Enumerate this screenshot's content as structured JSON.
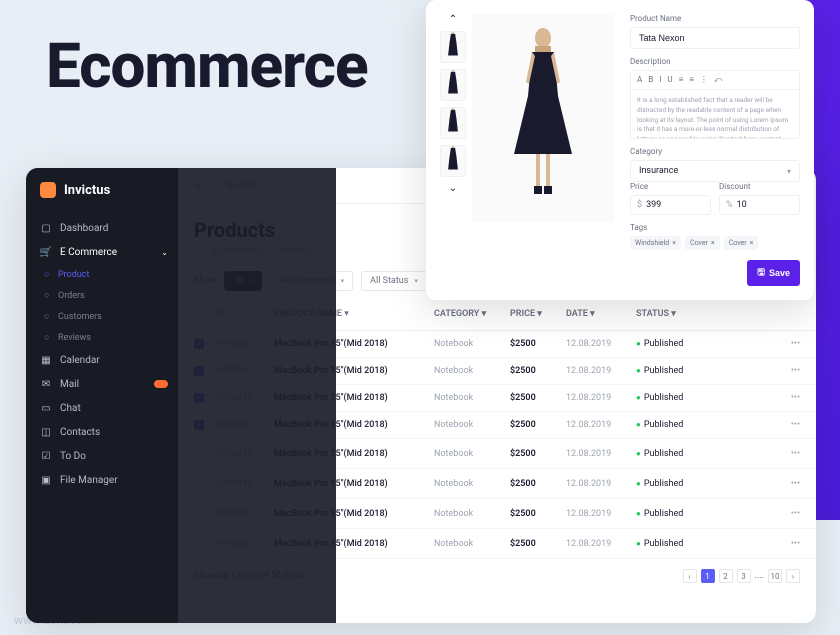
{
  "hero_title": "Ecommerce",
  "watermark": "www.25xt.com",
  "brand": "Invictus",
  "nav": {
    "dashboard": "Dashboard",
    "ecommerce": "E Commerce",
    "sub": [
      "Orders",
      "Customers",
      "Reviews"
    ],
    "sub_active": "Product",
    "calendar": "Calendar",
    "mail": "Mail",
    "chat": "Chat",
    "contacts": "Contacts",
    "todo": "To Do",
    "files": "File Manager"
  },
  "search_placeholder": "Search",
  "page_title": "Products",
  "crumbs": [
    "E COMMERCE",
    "PRODUCT"
  ],
  "filters": {
    "show_label": "Show",
    "page_size": "10",
    "category": "All Categories",
    "status": "All Status"
  },
  "table": {
    "headers": {
      "id": "ID",
      "name": "PRODUCT NAME",
      "cat": "CATEGORY",
      "price": "PRICE",
      "date": "DATE",
      "status": "STATUS"
    },
    "rows": [
      {
        "checked": true,
        "id": "#790841",
        "name": "MacBook Pro 15\"(Mid 2018)",
        "cat": "Notebook",
        "price": "$2500",
        "date": "12.08.2019",
        "status": "Published"
      },
      {
        "checked": true,
        "id": "#790841",
        "name": "MacBook Pro 15\"(Mid 2018)",
        "cat": "Notebook",
        "price": "$2500",
        "date": "12.08.2019",
        "status": "Published"
      },
      {
        "checked": true,
        "id": "#790841",
        "name": "MacBook Pro 15\"(Mid 2018)",
        "cat": "Notebook",
        "price": "$2500",
        "date": "12.08.2019",
        "status": "Published"
      },
      {
        "checked": true,
        "id": "#790841",
        "name": "MacBook Pro 15\"(Mid 2018)",
        "cat": "Notebook",
        "price": "$2500",
        "date": "12.08.2019",
        "status": "Published"
      },
      {
        "checked": false,
        "id": "#790841",
        "name": "MacBook Pro 15\"(Mid 2018)",
        "cat": "Notebook",
        "price": "$2500",
        "date": "12.08.2019",
        "status": "Published"
      },
      {
        "checked": false,
        "id": "#790841",
        "name": "MacBook Pro 15\"(Mid 2018)",
        "cat": "Notebook",
        "price": "$2500",
        "date": "12.08.2019",
        "status": "Published"
      },
      {
        "checked": false,
        "id": "#790841",
        "name": "MacBook Pro 15\"(Mid 2018)",
        "cat": "Notebook",
        "price": "$2500",
        "date": "12.08.2019",
        "status": "Published"
      },
      {
        "checked": false,
        "id": "#790841",
        "name": "MacBook Pro 15\"(Mid 2018)",
        "cat": "Notebook",
        "price": "$2500",
        "date": "12.08.2019",
        "status": "Published"
      }
    ],
    "footer": "Showing 1 to 10 of 50 items",
    "pages": [
      "1",
      "2",
      "3",
      "....",
      "10"
    ]
  },
  "modal": {
    "name_label": "Product Name",
    "name_value": "Tata Nexon",
    "desc_label": "Description",
    "desc_value": "It is a long established fact that a reader will be distracted by the readable content of a page when looking at its layout. The point of using Lorem Ipsum is that it has a more-or-less normal distribution of letters, as opposed to using 'Content here, content here', making the point of using.",
    "rte_tools": [
      "A",
      "B",
      "I",
      "U",
      "≡",
      "≡",
      "⋮",
      "⤺"
    ],
    "cat_label": "Category",
    "cat_value": "Insurance",
    "price_label": "Price",
    "price_currency": "$",
    "price_value": "399",
    "discount_label": "Discount",
    "discount_symbol": "%",
    "discount_value": "10",
    "tags_label": "Tags",
    "tags": [
      "Windshield",
      "Cover",
      "Cover"
    ],
    "save": "Save"
  }
}
